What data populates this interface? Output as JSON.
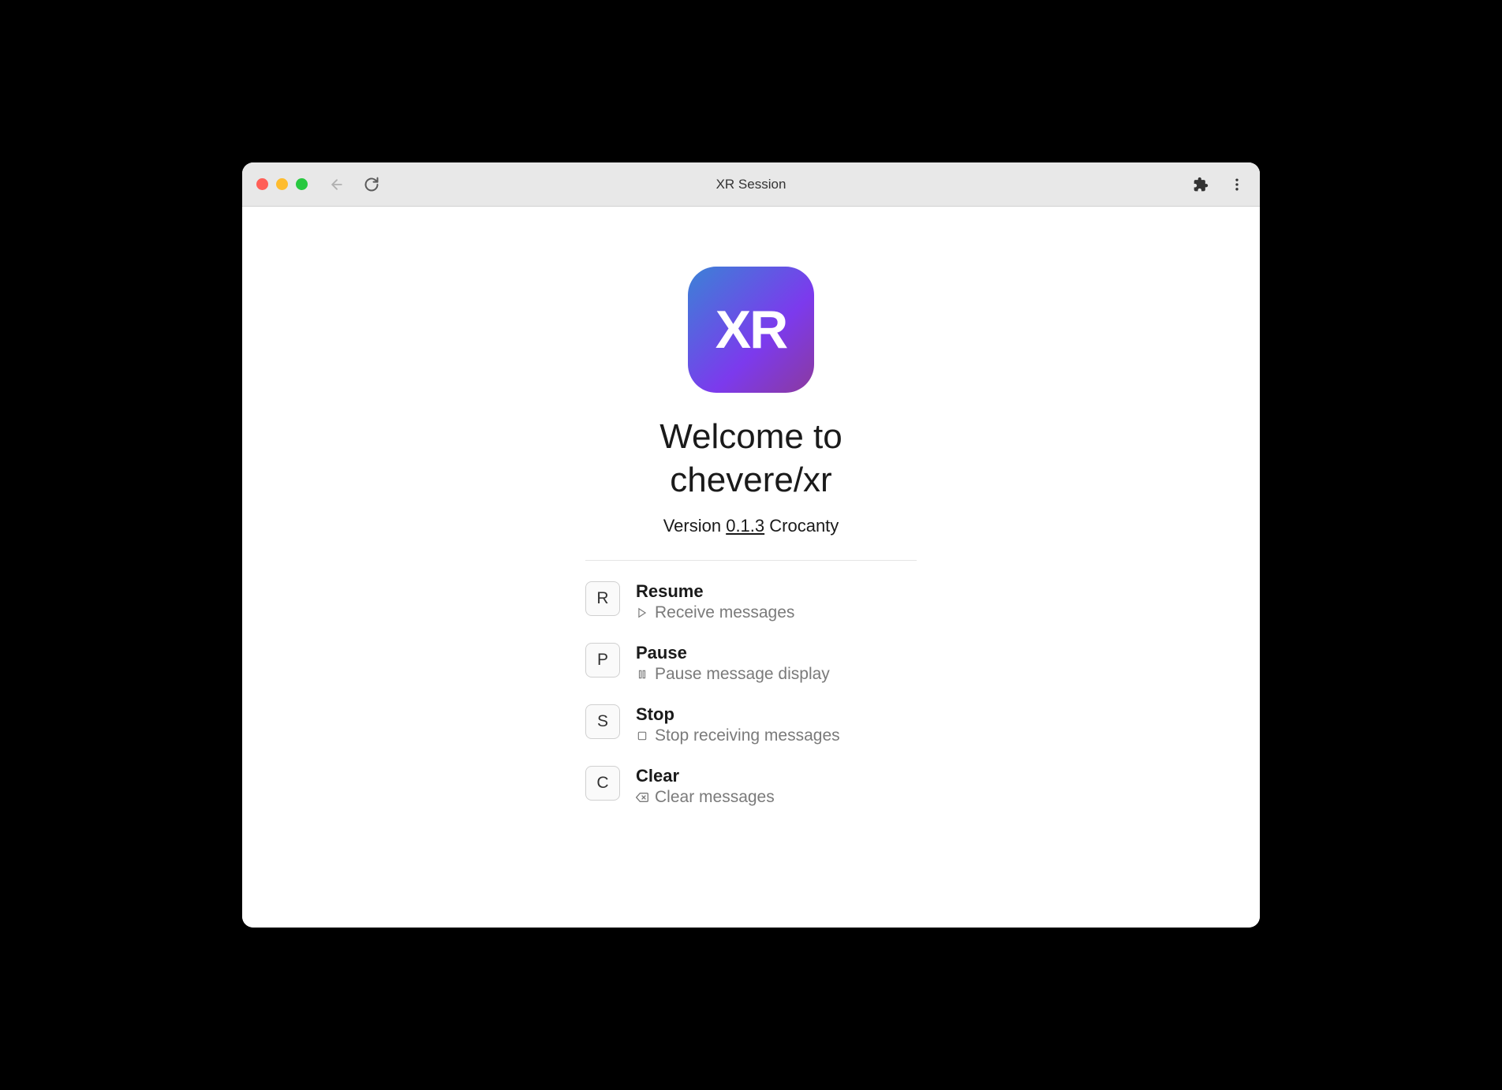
{
  "window": {
    "title": "XR Session"
  },
  "logo": {
    "text": "XR"
  },
  "heading": {
    "line1": "Welcome to",
    "line2": "chevere/xr"
  },
  "version": {
    "prefix": "Version ",
    "number": "0.1.3",
    "codename": " Crocanty"
  },
  "commands": [
    {
      "key": "R",
      "title": "Resume",
      "desc": "Receive messages",
      "icon": "play"
    },
    {
      "key": "P",
      "title": "Pause",
      "desc": "Pause message display",
      "icon": "pause"
    },
    {
      "key": "S",
      "title": "Stop",
      "desc": "Stop receiving messages",
      "icon": "stop"
    },
    {
      "key": "C",
      "title": "Clear",
      "desc": "Clear messages",
      "icon": "clear"
    }
  ]
}
